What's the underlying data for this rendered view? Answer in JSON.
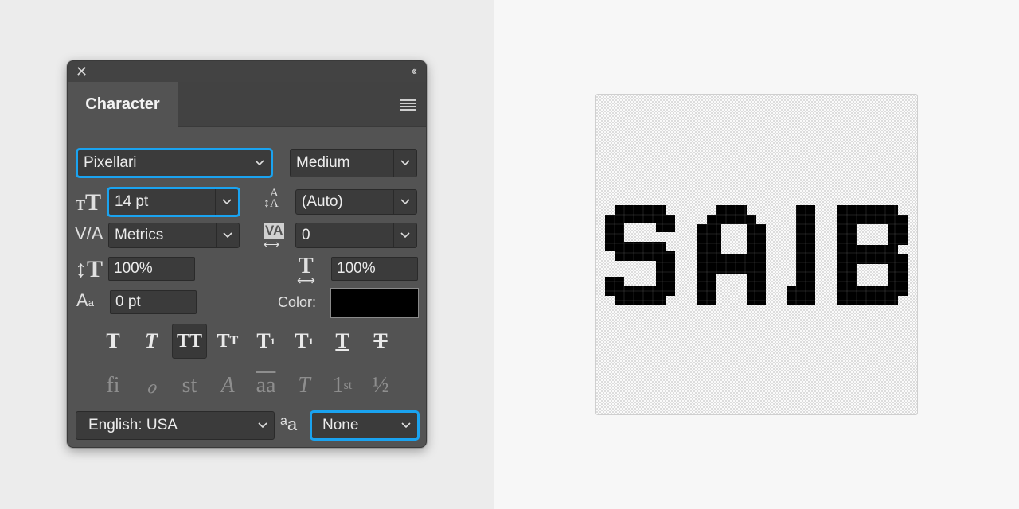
{
  "panel": {
    "close_icon": "close-icon",
    "collapse_glyph": "‹‹",
    "tab_label": "Character",
    "menu_icon": "hamburger-menu-icon"
  },
  "font": {
    "family": "Pixellari",
    "style": "Medium"
  },
  "size": {
    "font_size": "14 pt",
    "leading": "(Auto)"
  },
  "kerning": {
    "kerning": "Metrics",
    "tracking": "0"
  },
  "scale": {
    "vertical": "100%",
    "horizontal": "100%"
  },
  "baseline": {
    "shift": "0 pt",
    "color_label": "Color:",
    "color_value": "#000000"
  },
  "styles": [
    "T",
    "T",
    "TT",
    "TT",
    "T",
    "T",
    "T",
    "T"
  ],
  "opentype": [
    "fi",
    "ℴ",
    "st",
    "𝒜",
    "aa",
    "T",
    "1st",
    "½"
  ],
  "footer": {
    "language": "English: USA",
    "anti_alias_icon": "aa",
    "anti_alias": "None"
  },
  "canvas": {
    "text": "SAIB"
  },
  "colors": {
    "focus": "#1aa3f0",
    "panel_bg": "#535353",
    "field_bg": "#3b3b3b"
  }
}
